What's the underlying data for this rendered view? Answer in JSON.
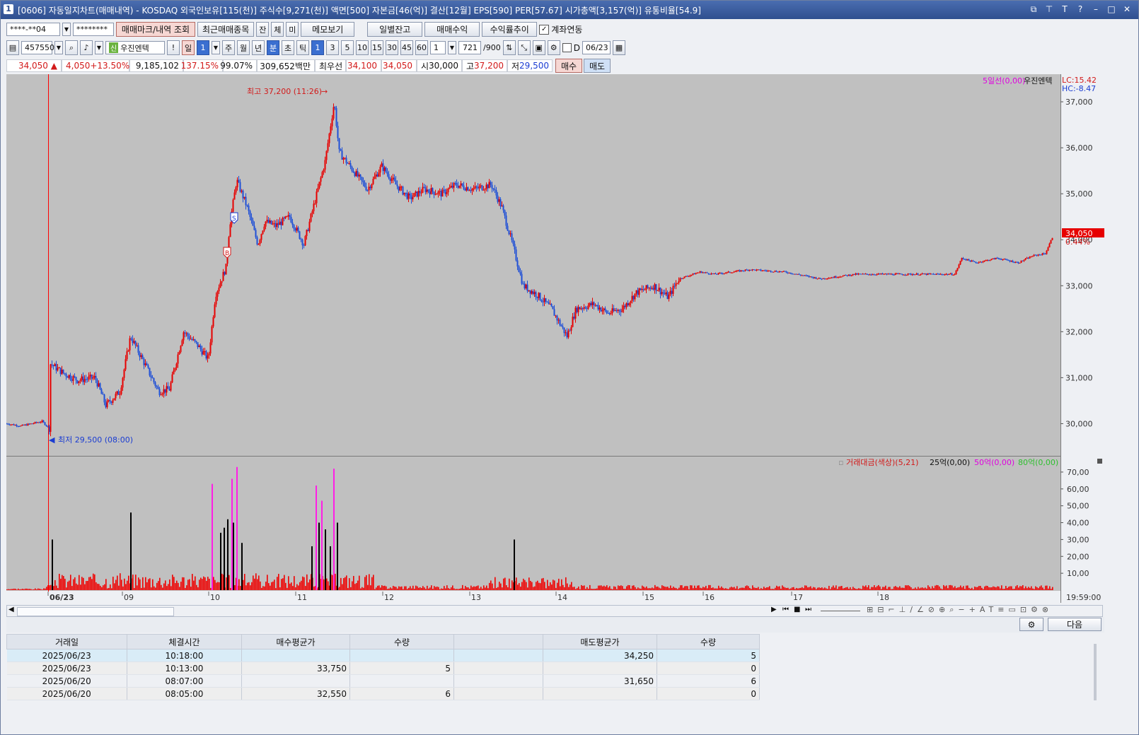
{
  "window": {
    "title": "[0606] 자동일지차트(매매내역) - KOSDAQ 외국인보유[115(천)] 주식수[9,271(천)] 액면[500] 자본금[46(억)] 결산[12월] EPS[590] PER[57.67] 시가총액[3,157(억)] 유통비율[54.9]",
    "icon_label": "1"
  },
  "toolbar1": {
    "account": "****-**04",
    "password": "********",
    "btn_trade_mark": "매매마크/내역 조회",
    "btn_recent": "최근매매종목",
    "btn_jan": "잔",
    "btn_che": "체",
    "btn_mi": "미",
    "btn_memo": "메모보기",
    "btn_daily_balance": "일별잔고",
    "btn_trade_profit": "매매수익",
    "btn_return_trend": "수익률추이",
    "account_link_label": "계좌연동"
  },
  "toolbar2": {
    "code": "457550",
    "stock_name": "우진엔텍",
    "badge": "신",
    "period_day": "일",
    "period_num": "1",
    "period_week": "주",
    "period_month": "월",
    "period_year": "년",
    "unit_min": "분",
    "unit_sec": "초",
    "unit_tick": "틱",
    "intervals": [
      "1",
      "3",
      "5",
      "10",
      "15",
      "30",
      "45",
      "60"
    ],
    "multiplier": "1",
    "count": "721",
    "count_max": "/900",
    "date": "06/23",
    "d_label": "D"
  },
  "ticker": {
    "price": "34,050",
    "change": "4,050",
    "change_pct": "+13.50%",
    "volume": "9,185,102",
    "vol_ratio": "137.15%",
    "exec_strength": "99.07%",
    "trade_value": "309,652백만",
    "best_bid_label": "최우선",
    "best_ask": "34,100",
    "best_bid": "34,050",
    "open_label": "시",
    "open": "30,000",
    "high_label": "고",
    "high": "37,200",
    "low_label": "저",
    "low": "29,500",
    "buy_btn": "매수",
    "sell_btn": "매도"
  },
  "chart_data": {
    "type": "candlestick",
    "instrument": "우진엔텍",
    "legend_ma": "5일선(0,00)",
    "legend_name": "우진엔텍",
    "lc_label": "LC:15.42",
    "hc_label": "HC:-8.47",
    "price_axis": [
      "37,000",
      "36,000",
      "35,000",
      "34,000",
      "33,000",
      "32,000",
      "31,000",
      "30,000"
    ],
    "ylim": [
      29300,
      37600
    ],
    "current_price_tag": "34,050",
    "current_pct_tag": "0.44%",
    "high_annotation": "최고 37,200 (11:26)",
    "low_annotation": "최저 29,500 (08:00)",
    "marker_b": "B",
    "marker_s": "S",
    "day_labels": [
      "06/23",
      "09",
      "10",
      "11",
      "12",
      "13",
      "14",
      "15",
      "16",
      "17",
      "18"
    ],
    "time_label": "19:59:00",
    "price_path": [
      [
        0,
        30000
      ],
      [
        20,
        29950
      ],
      [
        50,
        30050
      ],
      [
        60,
        29900
      ],
      [
        62,
        31300
      ],
      [
        80,
        31100
      ],
      [
        100,
        30950
      ],
      [
        125,
        31000
      ],
      [
        140,
        30400
      ],
      [
        160,
        30700
      ],
      [
        175,
        31900
      ],
      [
        195,
        31300
      ],
      [
        215,
        30700
      ],
      [
        230,
        30750
      ],
      [
        250,
        32000
      ],
      [
        270,
        31700
      ],
      [
        285,
        31400
      ],
      [
        295,
        32800
      ],
      [
        310,
        33400
      ],
      [
        315,
        34300
      ],
      [
        325,
        35300
      ],
      [
        340,
        34700
      ],
      [
        355,
        33900
      ],
      [
        365,
        34400
      ],
      [
        380,
        34300
      ],
      [
        400,
        34500
      ],
      [
        420,
        33900
      ],
      [
        435,
        34800
      ],
      [
        450,
        35700
      ],
      [
        463,
        37000
      ],
      [
        470,
        35900
      ],
      [
        490,
        35500
      ],
      [
        510,
        35100
      ],
      [
        530,
        35600
      ],
      [
        550,
        35200
      ],
      [
        570,
        34900
      ],
      [
        590,
        35100
      ],
      [
        615,
        35000
      ],
      [
        635,
        35200
      ],
      [
        660,
        35100
      ],
      [
        685,
        35200
      ],
      [
        700,
        34700
      ],
      [
        715,
        33900
      ],
      [
        730,
        33000
      ],
      [
        750,
        32800
      ],
      [
        770,
        32500
      ],
      [
        792,
        31900
      ],
      [
        805,
        32500
      ],
      [
        830,
        32600
      ],
      [
        850,
        32400
      ],
      [
        870,
        32500
      ],
      [
        890,
        32850
      ],
      [
        915,
        33000
      ],
      [
        935,
        32750
      ],
      [
        950,
        33150
      ],
      [
        980,
        33300
      ],
      [
        1000,
        33250
      ],
      [
        1050,
        33350
      ],
      [
        1100,
        33300
      ],
      [
        1150,
        33150
      ],
      [
        1200,
        33250
      ],
      [
        1280,
        33250
      ],
      [
        1340,
        33250
      ],
      [
        1350,
        33600
      ],
      [
        1370,
        33500
      ],
      [
        1400,
        33600
      ],
      [
        1430,
        33500
      ],
      [
        1450,
        33650
      ],
      [
        1468,
        33700
      ],
      [
        1478,
        34050
      ]
    ],
    "volume_panel": {
      "legend_main": "거래대금(색상)(5,21)",
      "legend_25": "25억(0,00)",
      "legend_50": "50억(0,00)",
      "legend_80": "80억(0,00)",
      "axis": [
        "70,00",
        "60,00",
        "50,00",
        "40,00",
        "30,00",
        "20,00",
        "10,00"
      ],
      "ylim": [
        0,
        75
      ],
      "big_bars": [
        [
          64,
          30,
          "black"
        ],
        [
          175,
          46,
          "black"
        ],
        [
          290,
          63,
          "magenta"
        ],
        [
          302,
          34,
          "black"
        ],
        [
          307,
          37,
          "black"
        ],
        [
          312,
          42,
          "black"
        ],
        [
          318,
          66,
          "magenta"
        ],
        [
          320,
          40,
          "black"
        ],
        [
          325,
          73,
          "magenta"
        ],
        [
          332,
          28,
          "black"
        ],
        [
          437,
          62,
          "magenta"
        ],
        [
          431,
          26,
          "black"
        ],
        [
          441,
          40,
          "black"
        ],
        [
          445,
          53,
          "magenta"
        ],
        [
          450,
          36,
          "black"
        ],
        [
          457,
          26,
          "black"
        ],
        [
          462,
          72,
          "magenta"
        ],
        [
          467,
          40,
          "black"
        ],
        [
          717,
          30,
          "black"
        ]
      ]
    }
  },
  "bottom": {
    "next_btn": "다음",
    "columns": [
      "거래일",
      "체결시간",
      "매수평균가",
      "수량",
      "",
      "매도평균가",
      "수량"
    ],
    "rows": [
      [
        "2025/06/23",
        "10:18:00",
        "",
        "",
        "",
        "34,250",
        "5"
      ],
      [
        "2025/06/23",
        "10:13:00",
        "33,750",
        "5",
        "",
        "",
        "0"
      ],
      [
        "2025/06/20",
        "08:07:00",
        "",
        "",
        "",
        "31,650",
        "6"
      ],
      [
        "2025/06/20",
        "08:05:00",
        "32,550",
        "6",
        "",
        "",
        "0"
      ]
    ]
  }
}
